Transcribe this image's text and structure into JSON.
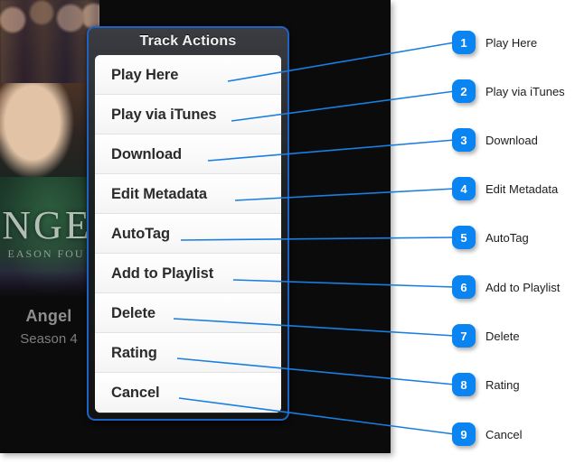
{
  "screenshot": {
    "media": {
      "poster_title_glyph": "NGE",
      "poster_subtitle_glyph": "EASON FOU",
      "title": "Angel",
      "subtitle": "Season 4"
    },
    "action_sheet": {
      "title": "Track Actions",
      "items": [
        {
          "label": "Play Here"
        },
        {
          "label": "Play via iTunes"
        },
        {
          "label": "Download"
        },
        {
          "label": "Edit Metadata"
        },
        {
          "label": "AutoTag"
        },
        {
          "label": "Add to Playlist"
        },
        {
          "label": "Delete"
        },
        {
          "label": "Rating"
        },
        {
          "label": "Cancel"
        }
      ]
    }
  },
  "annotations": [
    {
      "number": "1",
      "label": "Play Here"
    },
    {
      "number": "2",
      "label": "Play via iTunes"
    },
    {
      "number": "3",
      "label": "Download"
    },
    {
      "number": "4",
      "label": "Edit Metadata"
    },
    {
      "number": "5",
      "label": "AutoTag"
    },
    {
      "number": "6",
      "label": "Add to Playlist"
    },
    {
      "number": "7",
      "label": "Delete"
    },
    {
      "number": "8",
      "label": "Rating"
    },
    {
      "number": "9",
      "label": "Cancel"
    }
  ],
  "colors": {
    "accent_blue": "#0a84f0",
    "sheet_border_blue": "#1d63c4",
    "canvas_dark": "#0b0b0c",
    "item_text": "#2b2b2d"
  }
}
